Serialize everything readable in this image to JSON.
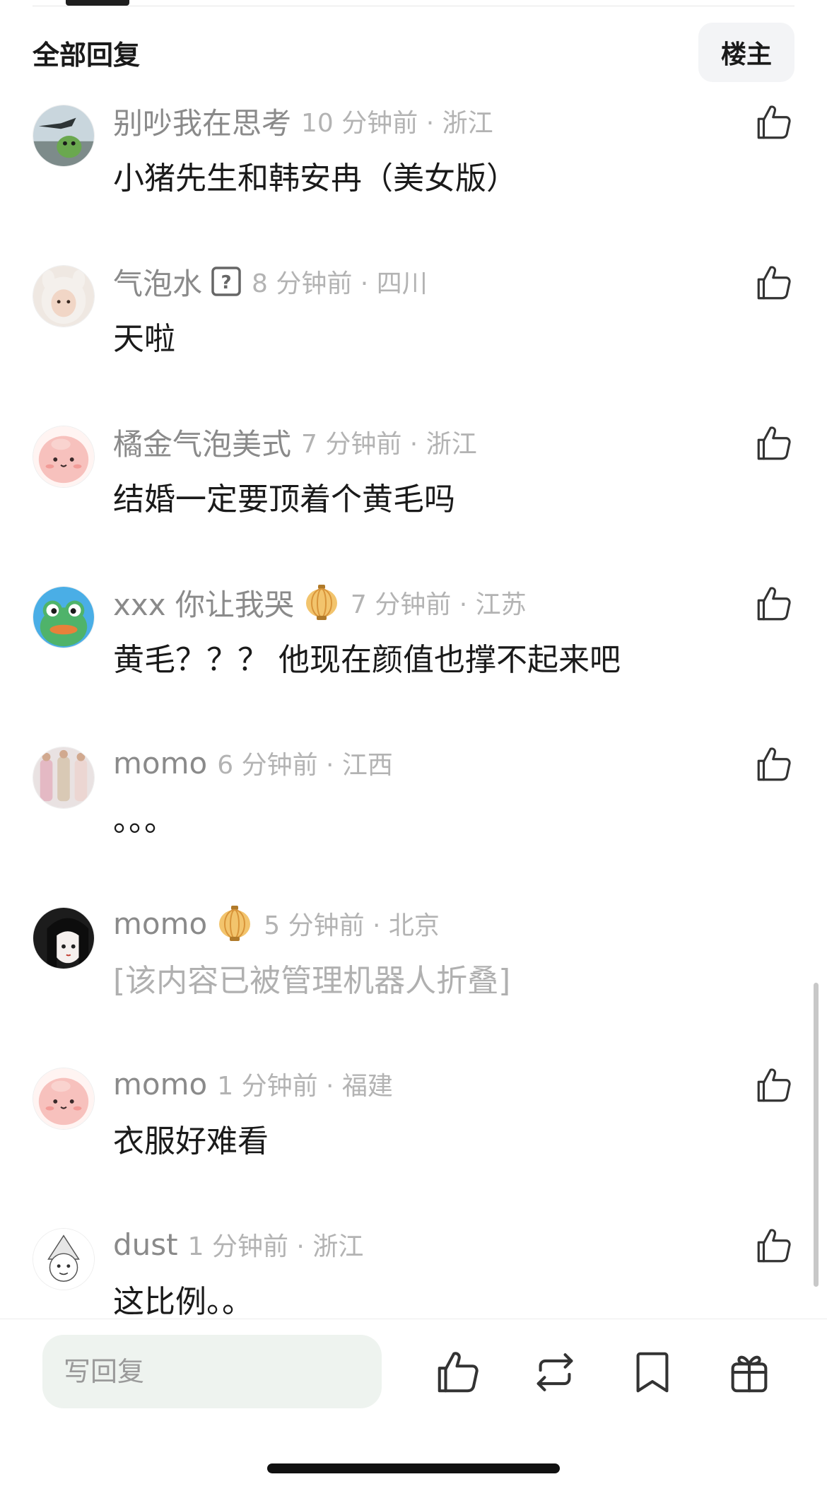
{
  "header": {
    "title": "全部回复",
    "op_button_label": "楼主"
  },
  "comments": [
    {
      "username": "别吵我在思考",
      "badge": null,
      "time_location": "10 分钟前 · 浙江",
      "text": "小猪先生和韩安冉（美女版）",
      "folded": false,
      "avatar": "goose-frog-avatar",
      "like": true
    },
    {
      "username": "气泡水",
      "badge": "question-badge",
      "time_location": "8 分钟前 · 四川",
      "text": "天啦",
      "folded": false,
      "avatar": "girl-hood-avatar",
      "like": true
    },
    {
      "username": "橘金气泡美式",
      "badge": null,
      "time_location": "7 分钟前 · 浙江",
      "text": "结婚一定要顶着个黄毛吗",
      "folded": false,
      "avatar": "pink-blob-avatar",
      "like": true
    },
    {
      "username": "xxx 你让我哭",
      "badge": "lantern-badge",
      "time_location": "7 分钟前 · 江苏",
      "text": "黄毛？？？ 他现在颜值也撑不起来吧",
      "folded": false,
      "avatar": "frog-avatar",
      "like": true
    },
    {
      "username": "momo",
      "badge": null,
      "time_location": "6 分钟前 · 江西",
      "text": "。。。",
      "folded": false,
      "avatar": "dress-photo-avatar",
      "like": true
    },
    {
      "username": "momo",
      "badge": "lantern-badge",
      "time_location": "5 分钟前 · 北京",
      "text": "[该内容已被管理机器人折叠]",
      "folded": true,
      "avatar": "anime-girl-avatar",
      "like": false
    },
    {
      "username": "momo",
      "badge": null,
      "time_location": "1 分钟前 · 福建",
      "text": "衣服好难看",
      "folded": false,
      "avatar": "pink-blob-avatar",
      "like": true
    },
    {
      "username": "dust",
      "badge": null,
      "time_location": "1 分钟前 · 浙江",
      "text": "这比例。。",
      "folded": false,
      "avatar": "sketch-avatar",
      "like": true
    }
  ],
  "reply_bar": {
    "placeholder": "写回复",
    "actions": [
      "like-icon",
      "repost-icon",
      "bookmark-icon",
      "gift-icon"
    ]
  },
  "colors": {
    "username": "#8a8a8a",
    "meta": "#b3b3b3",
    "text": "#1a1a1a",
    "folded_text": "#b0b0b0",
    "input_bg": "#eef3ef"
  }
}
